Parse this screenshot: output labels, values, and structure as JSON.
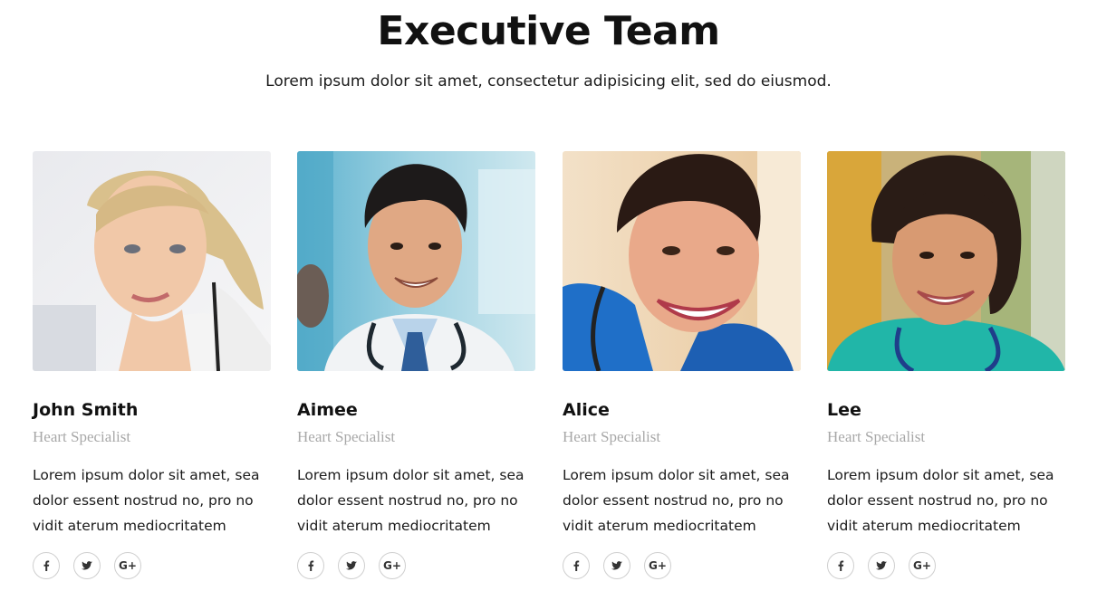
{
  "section": {
    "title": "Executive Team",
    "subtitle": "Lorem ipsum dolor sit amet, consectetur adipisicing elit, sed do eiusmod."
  },
  "members": [
    {
      "name": "John Smith",
      "role": "Heart Specialist",
      "bio": "Lorem ipsum dolor sit amet, sea dolor essent nostrud no, pro no vidit aterum mediocritatem",
      "socials": [
        "facebook-icon",
        "twitter-icon",
        "google-plus-icon"
      ]
    },
    {
      "name": "Aimee",
      "role": "Heart Specialist",
      "bio": "Lorem ipsum dolor sit amet, sea dolor essent nostrud no, pro no vidit aterum mediocritatem",
      "socials": [
        "facebook-icon",
        "twitter-icon",
        "google-plus-icon"
      ]
    },
    {
      "name": "Alice",
      "role": "Heart Specialist",
      "bio": "Lorem ipsum dolor sit amet, sea dolor essent nostrud no, pro no vidit aterum mediocritatem",
      "socials": [
        "facebook-icon",
        "twitter-icon",
        "google-plus-icon"
      ]
    },
    {
      "name": "Lee",
      "role": "Heart Specialist",
      "bio": "Lorem ipsum dolor sit amet, sea dolor essent nostrud no, pro no vidit aterum mediocritatem",
      "socials": [
        "facebook-icon",
        "twitter-icon",
        "google-plus-icon"
      ]
    }
  ],
  "social_glyphs": {
    "google_plus": "G+"
  },
  "colors": {
    "heading": "#111111",
    "muted": "#a8a8a8",
    "border": "#cfcfcf"
  }
}
